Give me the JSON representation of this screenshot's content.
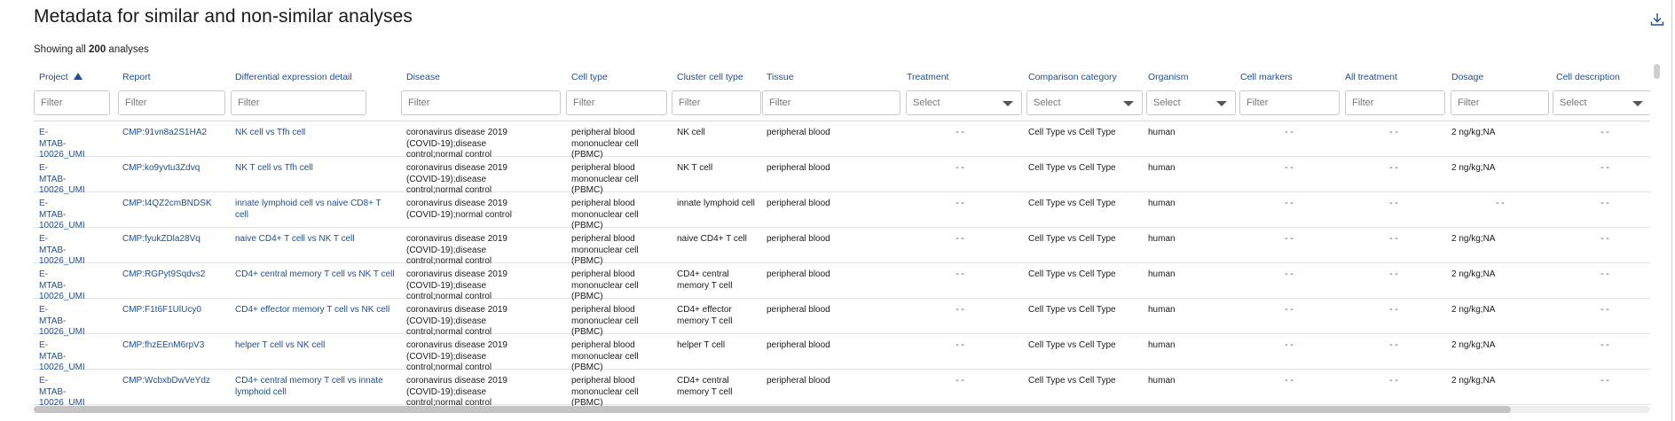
{
  "title": "Metadata for similar and non-similar analyses",
  "download_icon": "download-icon",
  "showing": {
    "prefix": "Showing all",
    "count": "200",
    "suffix": "analyses"
  },
  "columns": [
    {
      "key": "project",
      "label": "Project",
      "sort": "asc",
      "filter_type": "text",
      "placeholder": "Filter"
    },
    {
      "key": "report",
      "label": "Report",
      "filter_type": "text",
      "placeholder": "Filter"
    },
    {
      "key": "detail",
      "label": "Differential expression detail",
      "filter_type": "text",
      "placeholder": "Filter"
    },
    {
      "key": "disease",
      "label": "Disease",
      "filter_type": "text",
      "placeholder": "Filter"
    },
    {
      "key": "cell_type",
      "label": "Cell type",
      "filter_type": "text",
      "placeholder": "Filter"
    },
    {
      "key": "cluster",
      "label": "Cluster cell type",
      "filter_type": "text",
      "placeholder": "Filter"
    },
    {
      "key": "tissue",
      "label": "Tissue",
      "filter_type": "text",
      "placeholder": "Filter"
    },
    {
      "key": "treatment",
      "label": "Treatment",
      "filter_type": "select",
      "placeholder": "Select"
    },
    {
      "key": "comparison",
      "label": "Comparison category",
      "filter_type": "select",
      "placeholder": "Select"
    },
    {
      "key": "organism",
      "label": "Organism",
      "filter_type": "select",
      "placeholder": "Select"
    },
    {
      "key": "markers",
      "label": "Cell markers",
      "filter_type": "text",
      "placeholder": "Filter"
    },
    {
      "key": "all_treatment",
      "label": "All treatment",
      "filter_type": "text",
      "placeholder": "Filter"
    },
    {
      "key": "dosage",
      "label": "Dosage",
      "filter_type": "text",
      "placeholder": "Filter"
    },
    {
      "key": "description",
      "label": "Cell description",
      "filter_type": "select",
      "placeholder": "Select"
    }
  ],
  "rows": [
    {
      "project": "E-MTAB-10026_UMI",
      "report": "CMP:91vn8a2S1HA2",
      "detail": "NK cell vs Tfh cell",
      "disease": "coronavirus disease 2019 (COVID-19);disease control;normal control",
      "cell_type": "peripheral blood mononuclear cell (PBMC)",
      "cluster": "NK cell",
      "tissue": "peripheral blood",
      "treatment": "- -",
      "comparison": "Cell Type vs Cell Type",
      "organism": "human",
      "markers": "- -",
      "all_treatment": "- -",
      "dosage": "2 ng/kg;NA",
      "description": "- -"
    },
    {
      "project": "E-MTAB-10026_UMI",
      "report": "CMP:ko9yvtu3Zdvq",
      "detail": "NK T cell vs Tfh cell",
      "disease": "coronavirus disease 2019 (COVID-19);disease control;normal control",
      "cell_type": "peripheral blood mononuclear cell (PBMC)",
      "cluster": "NK T cell",
      "tissue": "peripheral blood",
      "treatment": "- -",
      "comparison": "Cell Type vs Cell Type",
      "organism": "human",
      "markers": "- -",
      "all_treatment": "- -",
      "dosage": "2 ng/kg;NA",
      "description": "- -"
    },
    {
      "project": "E-MTAB-10026_UMI",
      "report": "CMP:I4QZ2cmBNDSK",
      "detail": "innate lymphoid cell vs naive CD8+ T cell",
      "disease": "coronavirus disease 2019 (COVID-19);normal control",
      "cell_type": "peripheral blood mononuclear cell (PBMC)",
      "cluster": "innate lymphoid cell",
      "tissue": "peripheral blood",
      "treatment": "- -",
      "comparison": "Cell Type vs Cell Type",
      "organism": "human",
      "markers": "- -",
      "all_treatment": "- -",
      "dosage": "- -",
      "description": "- -"
    },
    {
      "project": "E-MTAB-10026_UMI",
      "report": "CMP:fyukZDla28Vq",
      "detail": "naive CD4+ T cell vs NK T cell",
      "disease": "coronavirus disease 2019 (COVID-19);disease control;normal control",
      "cell_type": "peripheral blood mononuclear cell (PBMC)",
      "cluster": "naive CD4+ T cell",
      "tissue": "peripheral blood",
      "treatment": "- -",
      "comparison": "Cell Type vs Cell Type",
      "organism": "human",
      "markers": "- -",
      "all_treatment": "- -",
      "dosage": "2 ng/kg;NA",
      "description": "- -"
    },
    {
      "project": "E-MTAB-10026_UMI",
      "report": "CMP:RGPyt9Sqdvs2",
      "detail": "CD4+ central memory T cell vs NK T cell",
      "disease": "coronavirus disease 2019 (COVID-19);disease control;normal control",
      "cell_type": "peripheral blood mononuclear cell (PBMC)",
      "cluster": "CD4+ central memory T cell",
      "tissue": "peripheral blood",
      "treatment": "- -",
      "comparison": "Cell Type vs Cell Type",
      "organism": "human",
      "markers": "- -",
      "all_treatment": "- -",
      "dosage": "2 ng/kg;NA",
      "description": "- -"
    },
    {
      "project": "E-MTAB-10026_UMI",
      "report": "CMP:F1t6F1UlUcy0",
      "detail": "CD4+ effector memory T cell vs NK cell",
      "disease": "coronavirus disease 2019 (COVID-19);disease control;normal control",
      "cell_type": "peripheral blood mononuclear cell (PBMC)",
      "cluster": "CD4+ effector memory T cell",
      "tissue": "peripheral blood",
      "treatment": "- -",
      "comparison": "Cell Type vs Cell Type",
      "organism": "human",
      "markers": "- -",
      "all_treatment": "- -",
      "dosage": "2 ng/kg;NA",
      "description": "- -"
    },
    {
      "project": "E-MTAB-10026_UMI",
      "report": "CMP:fhzEEnM6rpV3",
      "detail": "helper T cell vs NK cell",
      "disease": "coronavirus disease 2019 (COVID-19);disease control;normal control",
      "cell_type": "peripheral blood mononuclear cell (PBMC)",
      "cluster": "helper T cell",
      "tissue": "peripheral blood",
      "treatment": "- -",
      "comparison": "Cell Type vs Cell Type",
      "organism": "human",
      "markers": "- -",
      "all_treatment": "- -",
      "dosage": "2 ng/kg;NA",
      "description": "- -"
    },
    {
      "project": "E-MTAB-10026_UMI",
      "report": "CMP:WcbxbDwVeYdz",
      "detail": "CD4+ central memory T cell vs innate lymphoid cell",
      "disease": "coronavirus disease 2019 (COVID-19);disease control;normal control",
      "cell_type": "peripheral blood mononuclear cell (PBMC)",
      "cluster": "CD4+ central memory T cell",
      "tissue": "peripheral blood",
      "treatment": "- -",
      "comparison": "Cell Type vs Cell Type",
      "organism": "human",
      "markers": "- -",
      "all_treatment": "- -",
      "dosage": "2 ng/kg;NA",
      "description": "- -"
    }
  ]
}
